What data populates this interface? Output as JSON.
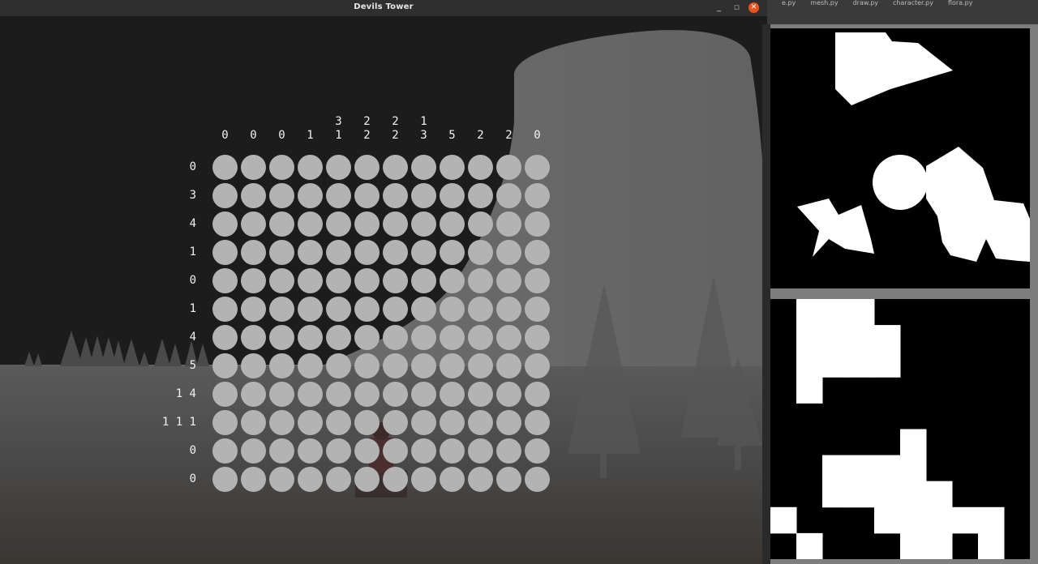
{
  "window": {
    "title": "Devils Tower",
    "controls": {
      "minimize": "_",
      "maximize": "□",
      "close": "✕"
    }
  },
  "editor_tabs": [
    "e.py",
    "mesh.py",
    "draw.py",
    "character.py",
    "flora.py"
  ],
  "nonogram": {
    "col_clues": [
      [
        "0"
      ],
      [
        "0"
      ],
      [
        "0"
      ],
      [
        "1"
      ],
      [
        "3",
        "1"
      ],
      [
        "2",
        "2"
      ],
      [
        "2",
        "2"
      ],
      [
        "1",
        "3"
      ],
      [
        "5"
      ],
      [
        "2"
      ],
      [
        "2"
      ],
      [
        "0"
      ]
    ],
    "row_clues": [
      [
        "0"
      ],
      [
        "3"
      ],
      [
        "4"
      ],
      [
        "1"
      ],
      [
        "0"
      ],
      [
        "1"
      ],
      [
        "4"
      ],
      [
        "5"
      ],
      [
        "1",
        "4"
      ],
      [
        "1",
        "1",
        "1"
      ],
      [
        "0"
      ],
      [
        "0"
      ]
    ],
    "cell_color": "#b3b3b3",
    "clue_color": "#f2f2f2"
  },
  "preview_grid": {
    "rows": 10,
    "cols": 10,
    "filled": [
      [
        0,
        1
      ],
      [
        0,
        2
      ],
      [
        0,
        3
      ],
      [
        1,
        1
      ],
      [
        1,
        2
      ],
      [
        1,
        3
      ],
      [
        1,
        4
      ],
      [
        2,
        1
      ],
      [
        2,
        2
      ],
      [
        2,
        3
      ],
      [
        2,
        4
      ],
      [
        3,
        1
      ],
      [
        5,
        5
      ],
      [
        6,
        2
      ],
      [
        6,
        3
      ],
      [
        6,
        4
      ],
      [
        6,
        5
      ],
      [
        7,
        2
      ],
      [
        7,
        3
      ],
      [
        7,
        4
      ],
      [
        7,
        5
      ],
      [
        7,
        6
      ],
      [
        8,
        0
      ],
      [
        8,
        4
      ],
      [
        8,
        5
      ],
      [
        8,
        6
      ],
      [
        8,
        7
      ],
      [
        8,
        8
      ],
      [
        9,
        1
      ],
      [
        9,
        5
      ],
      [
        9,
        6
      ],
      [
        9,
        8
      ]
    ]
  },
  "colors": {
    "sky": "#1c1c1c",
    "fog": "#5f5f5f",
    "tower": "#6a6a6a",
    "titlebar": "#2f2f2f",
    "close_button": "#e95420",
    "preview_bg": "#000000",
    "preview_fg": "#ffffff"
  }
}
